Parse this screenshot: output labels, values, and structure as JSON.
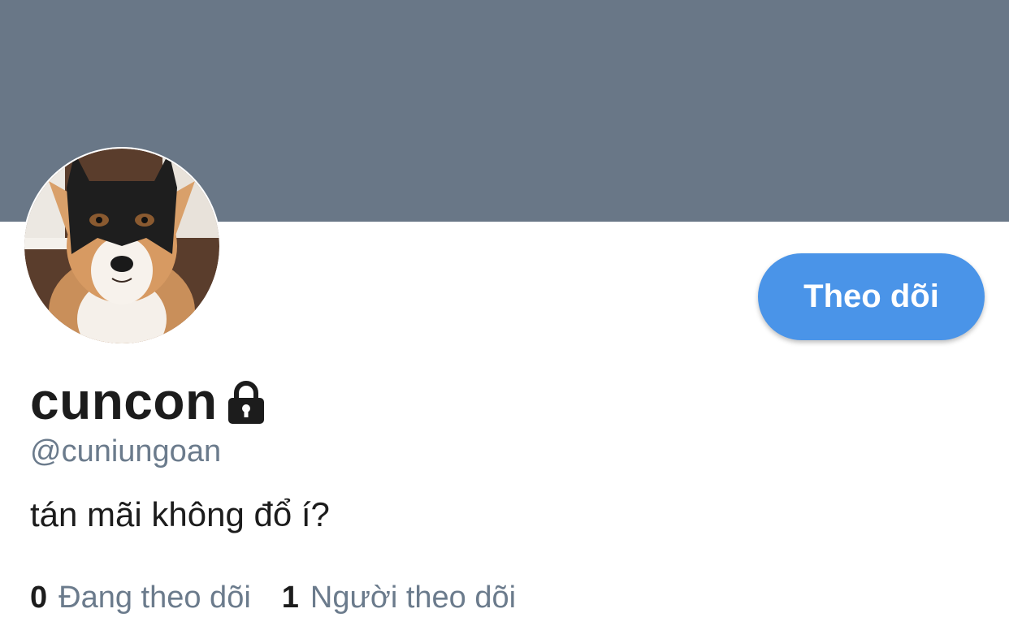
{
  "colors": {
    "banner": "#697787",
    "accent": "#4a94e8",
    "muted": "#6b7b8c",
    "text": "#1c1c1c"
  },
  "profile": {
    "display_name": "cuncon",
    "handle": "@cuniungoan",
    "bio": "tán mãi không đổ í?",
    "protected_icon": "lock-icon",
    "avatar_icon": "avatar-dog-batman-mask"
  },
  "actions": {
    "follow_label": "Theo dõi"
  },
  "stats": {
    "following_count": "0",
    "following_label": "Đang theo dõi",
    "followers_count": "1",
    "followers_label": "Người theo dõi"
  }
}
